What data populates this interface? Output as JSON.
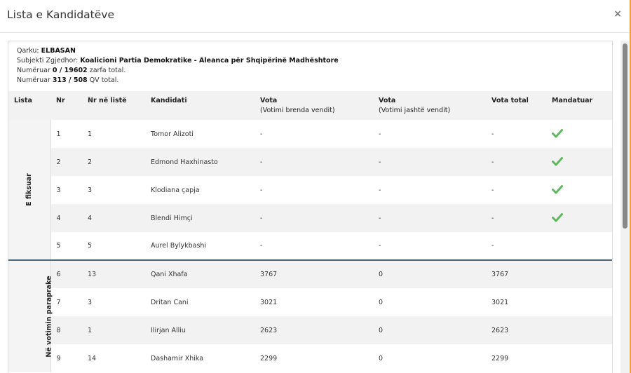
{
  "modal": {
    "title": "Lista e Kandidatëve",
    "close": "×"
  },
  "info": {
    "qarku_label": "Qarku:",
    "qarku_value": "ELBASAN",
    "subjekti_label": "Subjekti Zgjedhor:",
    "subjekti_value": "Koalicioni Partia Demokratike - Aleanca për Shqipërinë Madhështore",
    "numeruar1_label": "Numëruar",
    "numeruar1_value": "0 / 19602",
    "numeruar1_suffix": "zarfa total.",
    "numeruar2_label": "Numëruar",
    "numeruar2_value": "313 / 508",
    "numeruar2_suffix": "QV total."
  },
  "table": {
    "headers": {
      "lista": "Lista",
      "nr": "Nr",
      "nr_liste": "Nr në listë",
      "kandidati": "Kandidati",
      "vota_brenda": "Vota",
      "vota_brenda_sub": "(Votimi brenda vendit)",
      "vota_jashte": "Vota",
      "vota_jashte_sub": "(Votimi jashtë vendit)",
      "vota_total": "Vota total",
      "mandatuar": "Mandatuar"
    },
    "groups": {
      "fiksuar": "E fiksuar",
      "paraprake": "Në votimin paraprake"
    },
    "rows": [
      {
        "nr": "1",
        "nr_liste": "1",
        "kandidati": "Tomor Alizoti",
        "brenda": "-",
        "jashte": "-",
        "total": "-",
        "mandatuar": true
      },
      {
        "nr": "2",
        "nr_liste": "2",
        "kandidati": "Edmond Haxhinasto",
        "brenda": "-",
        "jashte": "-",
        "total": "-",
        "mandatuar": true
      },
      {
        "nr": "3",
        "nr_liste": "3",
        "kandidati": "Klodiana çapja",
        "brenda": "-",
        "jashte": "-",
        "total": "-",
        "mandatuar": true
      },
      {
        "nr": "4",
        "nr_liste": "4",
        "kandidati": "Blendi Himçi",
        "brenda": "-",
        "jashte": "-",
        "total": "-",
        "mandatuar": true
      },
      {
        "nr": "5",
        "nr_liste": "5",
        "kandidati": "Aurel Bylykbashi",
        "brenda": "-",
        "jashte": "-",
        "total": "-",
        "mandatuar": false
      },
      {
        "nr": "6",
        "nr_liste": "13",
        "kandidati": "Qani Xhafa",
        "brenda": "3767",
        "jashte": "0",
        "total": "3767",
        "mandatuar": false
      },
      {
        "nr": "7",
        "nr_liste": "3",
        "kandidati": "Dritan Cani",
        "brenda": "3021",
        "jashte": "0",
        "total": "3021",
        "mandatuar": false
      },
      {
        "nr": "8",
        "nr_liste": "1",
        "kandidati": "Ilirjan Alliu",
        "brenda": "2623",
        "jashte": "0",
        "total": "2623",
        "mandatuar": false
      },
      {
        "nr": "9",
        "nr_liste": "14",
        "kandidati": "Dashamir Xhika",
        "brenda": "2299",
        "jashte": "0",
        "total": "2299",
        "mandatuar": false
      }
    ]
  },
  "colors": {
    "check": "#5cb85c",
    "separator": "#4a6478",
    "accent_edge": "#f0a040"
  },
  "icons": {
    "check": "check-icon",
    "close": "close-icon"
  }
}
